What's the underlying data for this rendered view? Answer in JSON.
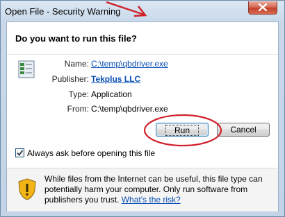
{
  "window": {
    "title": "Open File - Security Warning"
  },
  "content": {
    "question": "Do you want to run this file?",
    "fields": [
      {
        "label": "Name:",
        "value": "C:\\temp\\qbdriver.exe"
      },
      {
        "label": "Publisher:",
        "value": "Tekplus LLC"
      },
      {
        "label": "Type:",
        "value": "Application"
      },
      {
        "label": "From:",
        "value": "C:\\temp\\qbdriver.exe"
      }
    ],
    "buttons": {
      "run": "Run",
      "cancel": "Cancel"
    },
    "checkbox": {
      "label": "Always ask before opening this file",
      "checked": true
    },
    "warning": {
      "text": "While files from the Internet can be useful, this file type can potentially harm your computer. Only run software from publishers you trust.",
      "link": "What's the risk?"
    }
  },
  "icons": [
    "close-icon",
    "file-icon",
    "shield-warning-icon",
    "checkmark-icon"
  ],
  "colors": {
    "link": "#0b4fb5",
    "annotation": "#d0202a",
    "close_button": "#c3402a"
  }
}
